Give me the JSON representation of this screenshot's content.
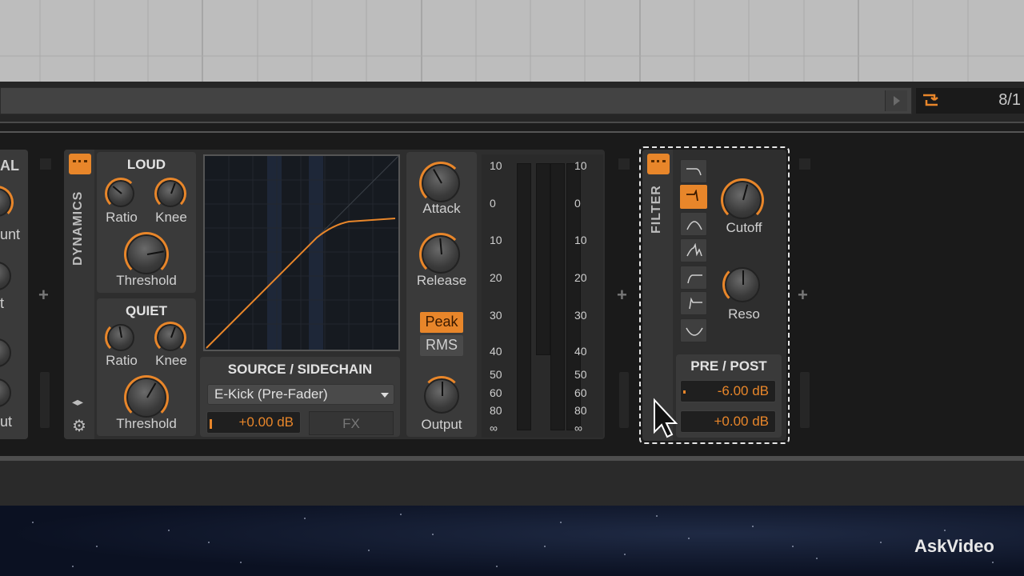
{
  "transport": {
    "position": "8/1"
  },
  "prev_device": {
    "labels": [
      "AL",
      "unt",
      "t",
      "ut"
    ]
  },
  "dynamics": {
    "title": "DYNAMICS",
    "loud": {
      "title": "LOUD",
      "ratio_label": "Ratio",
      "knee_label": "Knee",
      "threshold_label": "Threshold"
    },
    "quiet": {
      "title": "QUIET",
      "ratio_label": "Ratio",
      "knee_label": "Knee",
      "threshold_label": "Threshold"
    },
    "sidechain": {
      "title": "SOURCE / SIDECHAIN",
      "source": "E-Kick (Pre-Fader)",
      "gain": "+0.00 dB",
      "fx_label": "FX"
    },
    "attack_label": "Attack",
    "release_label": "Release",
    "output_label": "Output",
    "detect_modes": {
      "peak": "Peak",
      "rms": "RMS",
      "active": "Peak"
    },
    "meter_scale": [
      "10",
      "0",
      "10",
      "20",
      "30",
      "40",
      "50",
      "60",
      "80",
      "∞"
    ]
  },
  "filter": {
    "title": "FILTER",
    "cutoff_label": "Cutoff",
    "reso_label": "Reso",
    "prepost": {
      "title": "PRE / POST",
      "pre_gain": "-6.00 dB",
      "post_gain": "+0.00 dB"
    },
    "types": [
      "lowpass-1-icon",
      "lowpass-2-icon",
      "bandpass-icon",
      "bandpass-peak-icon",
      "highpass-1-icon",
      "highpass-2-icon",
      "notch-icon"
    ],
    "active_type": 1
  },
  "watermark": "AskVideo",
  "colors": {
    "accent": "#e8862a",
    "panel": "#2e2e2e",
    "text": "#d0d0d0"
  }
}
